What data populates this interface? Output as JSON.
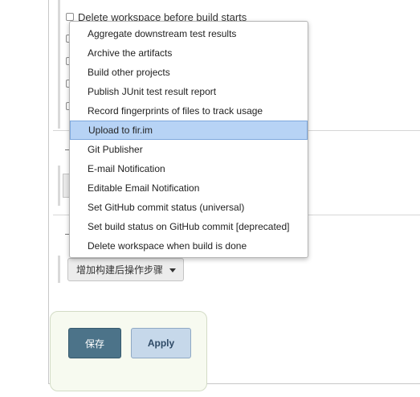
{
  "post_build": {
    "delete_workspace_option": {
      "label": "Delete workspace before build starts",
      "checked": false
    },
    "add_step_button": {
      "label": "增加构建后操作步骤"
    }
  },
  "dropdown_menu": {
    "selected_index": 5,
    "items": [
      {
        "label": "Aggregate downstream test results"
      },
      {
        "label": "Archive the artifacts"
      },
      {
        "label": "Build other projects"
      },
      {
        "label": "Publish JUnit test result report"
      },
      {
        "label": "Record fingerprints of files to track usage"
      },
      {
        "label": "Upload to fir.im"
      },
      {
        "label": "Git Publisher"
      },
      {
        "label": "E-mail Notification"
      },
      {
        "label": "Editable Email Notification"
      },
      {
        "label": "Set GitHub commit status (universal)"
      },
      {
        "label": "Set build status on GitHub commit [deprecated]"
      },
      {
        "label": "Delete workspace when build is done"
      }
    ]
  },
  "form_actions": {
    "save_label": "保存",
    "apply_label": "Apply"
  },
  "colors": {
    "save_button": "#4c7389",
    "apply_button": "#c6d8ea",
    "selected_item": "#b7d3f5",
    "save_panel": "#f7faf0"
  }
}
